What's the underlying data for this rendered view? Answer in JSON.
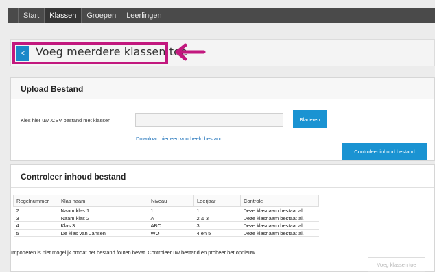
{
  "nav": {
    "tabs": [
      {
        "label": "Start",
        "active": false
      },
      {
        "label": "Klassen",
        "active": true
      },
      {
        "label": "Groepen",
        "active": false
      },
      {
        "label": "Leerlingen",
        "active": false
      }
    ]
  },
  "header": {
    "back_label": "<",
    "title": "Voeg meerdere klassen toe"
  },
  "upload": {
    "title": "Upload Bestand",
    "file_label": "Kies hier uw .CSV bestand met klassen",
    "file_value": "",
    "browse_label": "Bladeren",
    "download_link": "Download hier een voorbeeld bestand",
    "check_label": "Controleer inhoud bestand"
  },
  "control": {
    "title": "Controleer inhoud bestand",
    "columns": [
      "Regelnummer",
      "Klas naam",
      "Niveau",
      "Leerjaar",
      "Controle"
    ],
    "rows": [
      [
        "2",
        "Naam klas 1",
        "1",
        "1",
        "Deze klasnaam bestaat al."
      ],
      [
        "3",
        "Naam klas 2",
        "A",
        "2 & 3",
        "Deze klasnaam bestaat al."
      ],
      [
        "4",
        "Klas 3",
        "ABC",
        "3",
        "Deze klasnaam bestaat al."
      ],
      [
        "5",
        "De klas van Jansen",
        "WO",
        "4 en 5",
        "Deze klasnaam bestaat al."
      ]
    ],
    "error_message": "Importeren is niet mogelijk omdat het bestand fouten bevat. Controleer uw bestand en probeer het opnieuw.",
    "import_label": "Voeg klassen toe"
  },
  "colors": {
    "accent": "#1a93d2",
    "highlight": "#c2187e",
    "nav_bg": "#4a4a4a"
  },
  "icons": {
    "back": "chevron-left-icon",
    "annotation": "arrow-left-icon"
  }
}
